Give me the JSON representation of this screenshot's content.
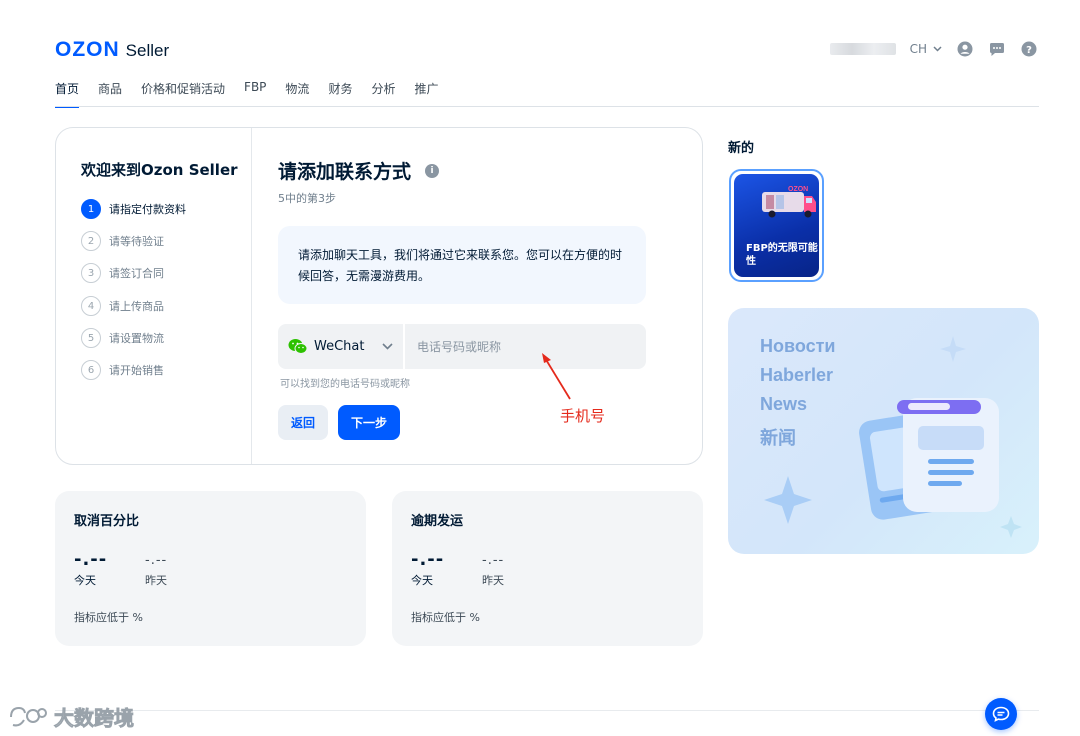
{
  "header": {
    "brand_logo": "OZON",
    "brand_suffix": "Seller",
    "language": "CH"
  },
  "nav": [
    {
      "label": "首页",
      "active": true
    },
    {
      "label": "商品"
    },
    {
      "label": "价格和促销活动"
    },
    {
      "label": "FBP"
    },
    {
      "label": "物流"
    },
    {
      "label": "财务"
    },
    {
      "label": "分析"
    },
    {
      "label": "推广"
    }
  ],
  "onboarding": {
    "welcome": "欢迎来到Ozon Seller",
    "steps": [
      {
        "num": "1",
        "label": "请指定付款资料",
        "active": true
      },
      {
        "num": "2",
        "label": "请等待验证"
      },
      {
        "num": "3",
        "label": "请签订合同"
      },
      {
        "num": "4",
        "label": "请上传商品"
      },
      {
        "num": "5",
        "label": "请设置物流"
      },
      {
        "num": "6",
        "label": "请开始销售"
      }
    ],
    "title": "请添加联系方式",
    "step_text": "5中的第3步",
    "notice": "请添加聊天工具，我们将通过它来联系您。您可以在方便的时候回答，无需漫游费用。",
    "messenger": "WeChat",
    "input_placeholder": "电话号码或昵称",
    "input_value": "",
    "hint": "可以找到您的电话号码或昵称",
    "back_label": "返回",
    "next_label": "下一步"
  },
  "annotation": "手机号",
  "news": {
    "new_label": "新的",
    "story_title": "FBP的无限可能性",
    "langs": [
      "Новости",
      "Haberler",
      "News",
      "新闻"
    ]
  },
  "metrics": [
    {
      "title": "取消百分比",
      "today_value": "-.--",
      "yesterday_value": "-.--",
      "today_label": "今天",
      "yesterday_label": "昨天",
      "footer": "指标应低于 %"
    },
    {
      "title": "逾期发运",
      "today_value": "-.--",
      "yesterday_value": "-.--",
      "today_label": "今天",
      "yesterday_label": "昨天",
      "footer": "指标应低于 %"
    }
  ],
  "watermark": "大数跨境",
  "colors": {
    "accent": "#005bff",
    "annotation": "#e42a1c",
    "wechat": "#2dc100"
  }
}
